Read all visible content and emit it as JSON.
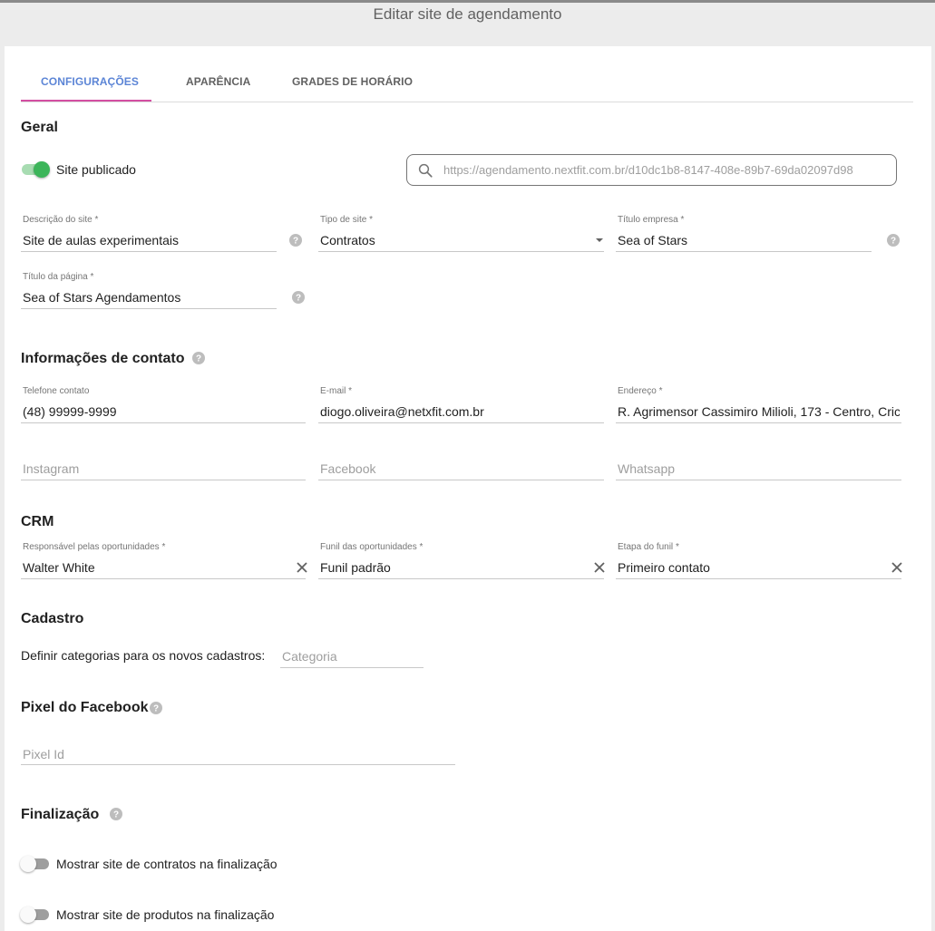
{
  "page": {
    "title": "Editar site de agendamento"
  },
  "tabs": [
    {
      "label": "CONFIGURAÇÕES",
      "active": true
    },
    {
      "label": "APARÊNCIA",
      "active": false
    },
    {
      "label": "GRADES DE HORÁRIO",
      "active": false
    }
  ],
  "general": {
    "title": "Geral",
    "published_toggle": {
      "label": "Site publicado",
      "on": true
    },
    "url_search": {
      "value": "https://agendamento.nextfit.com.br/d10dc1b8-8147-408e-89b7-69da02097d98"
    },
    "site_description": {
      "label": "Descrição do site",
      "required": "*",
      "value": "Site de aulas experimentais"
    },
    "site_type": {
      "label": "Tipo de site",
      "required": "*",
      "value": "Contratos"
    },
    "company_title": {
      "label": "Título empresa",
      "required": "*",
      "value": "Sea of Stars"
    },
    "page_title": {
      "label": "Título da página",
      "required": "*",
      "value": "Sea of Stars Agendamentos"
    }
  },
  "contact": {
    "title": "Informações de contato",
    "phone": {
      "label": "Telefone contato",
      "value": "(48) 99999-9999"
    },
    "email": {
      "label": "E-mail",
      "required": "*",
      "value": "diogo.oliveira@netxfit.com.br"
    },
    "address": {
      "label": "Endereço",
      "required": "*",
      "value": "R. Agrimensor Cassimiro Milioli, 173 - Centro, Cric"
    },
    "instagram": {
      "placeholder": "Instagram"
    },
    "facebook": {
      "placeholder": "Facebook"
    },
    "whatsapp": {
      "placeholder": "Whatsapp"
    }
  },
  "crm": {
    "title": "CRM",
    "owner": {
      "label": "Responsável pelas oportunidades",
      "required": "*",
      "value": "Walter White"
    },
    "funnel": {
      "label": "Funil das oportunidades",
      "required": "*",
      "value": "Funil padrão"
    },
    "stage": {
      "label": "Etapa do funil",
      "required": "*",
      "value": "Primeiro contato"
    }
  },
  "registration": {
    "title": "Cadastro",
    "categories_label": "Definir categorias para os novos cadastros:",
    "category_placeholder": "Categoria"
  },
  "facebook_pixel": {
    "title": "Pixel do Facebook",
    "pixel_placeholder": "Pixel Id"
  },
  "finalization": {
    "title": "Finalização",
    "show_contracts": {
      "label": "Mostrar site de contratos na finalização",
      "on": false
    },
    "show_products": {
      "label": "Mostrar site de produtos na finalização",
      "on": false
    }
  },
  "colors": {
    "accent_blue": "#5c85d6",
    "tab_indicator": "#d34ea1",
    "toggle_on_knob": "#3cb55a",
    "toggle_on_track": "#a8dcb2",
    "toggle_off_knob": "#fafafa",
    "toggle_off_track": "#9e9e9e",
    "help_icon": "#bdbdbd"
  }
}
